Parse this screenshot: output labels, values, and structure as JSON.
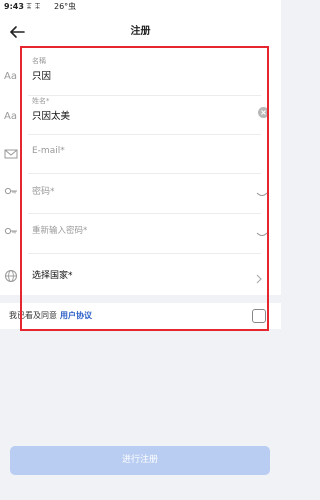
{
  "status_bar": {
    "time": "9:43",
    "signal": "ꔯ ꔯ",
    "temperature": "26°",
    "extra": "虫"
  },
  "nav": {
    "title": "注册"
  },
  "form": {
    "nickname_caption": "名稱",
    "nickname_value": "只因",
    "name_caption": "姓名*",
    "name_value": "只因太美",
    "email_placeholder": "E-mail*",
    "password_placeholder": "密码*",
    "repeat_password_placeholder": "重新输入密码*",
    "country_label": "选择国家*"
  },
  "agreement": {
    "text": "我已看及同意",
    "link": "用户协议"
  },
  "submit": {
    "label": "进行注册"
  },
  "colors": {
    "accent": "#2e62c8",
    "button_disabled": "#b9cdf2",
    "highlight": "#e5262e"
  }
}
